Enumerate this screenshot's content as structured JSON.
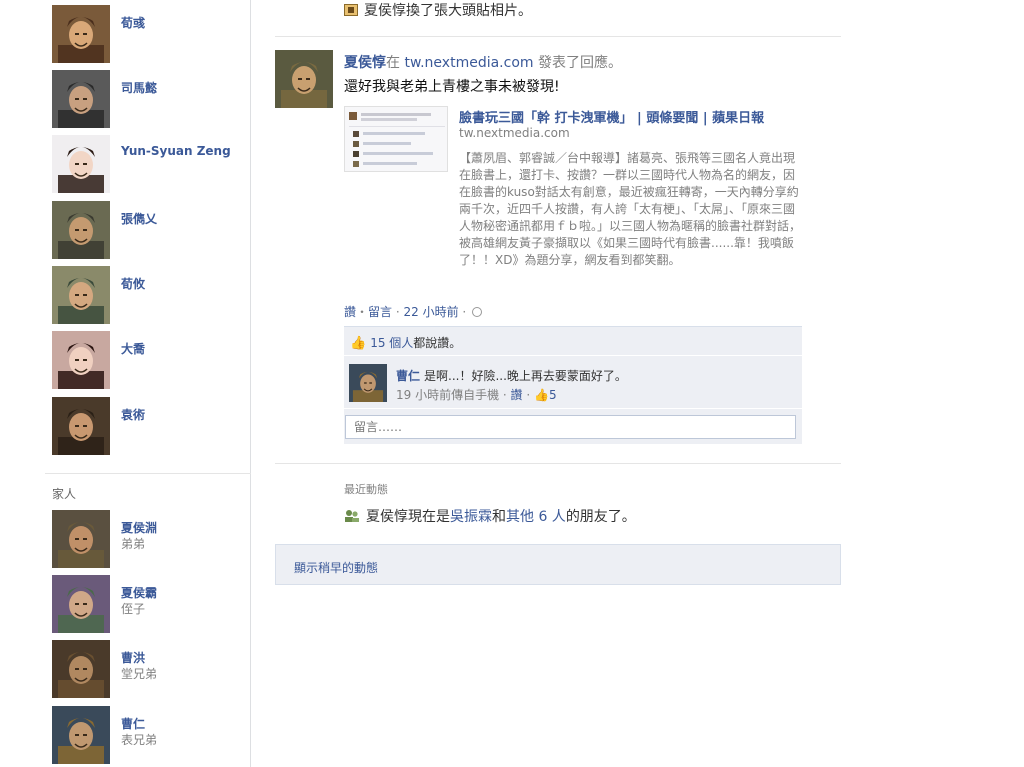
{
  "sidebar": {
    "friends": [
      {
        "name": "荀彧",
        "palette": {
          "bg": "#7a5a3a",
          "face": "#d9a878",
          "hat": "#4a2e1c"
        }
      },
      {
        "name": "司馬懿",
        "palette": {
          "bg": "#5a5a5a",
          "face": "#c8a080",
          "hat": "#2a2a2a"
        }
      },
      {
        "name": "Yun-Syuan Zeng",
        "palette": {
          "bg": "#f0eef0",
          "face": "#f2d6c6",
          "hat": "#2a1a14"
        }
      },
      {
        "name": "張儁乂",
        "palette": {
          "bg": "#6a6a52",
          "face": "#c49a70",
          "hat": "#3a3a30"
        }
      },
      {
        "name": "荀攸",
        "palette": {
          "bg": "#8a8a6a",
          "face": "#d4a880",
          "hat": "#3a4a3a"
        }
      },
      {
        "name": "大喬",
        "palette": {
          "bg": "#c8a8a0",
          "face": "#f0d0c0",
          "hat": "#2a1410"
        }
      },
      {
        "name": "袁術",
        "palette": {
          "bg": "#4a3a2a",
          "face": "#c89870",
          "hat": "#2a2016"
        }
      }
    ],
    "family_heading": "家人",
    "family": [
      {
        "name": "夏侯淵",
        "relation": "弟弟",
        "palette": {
          "bg": "#5a5040",
          "face": "#c09068",
          "hat": "#6a5a3a"
        }
      },
      {
        "name": "夏侯霸",
        "relation": "侄子",
        "palette": {
          "bg": "#6a5a7a",
          "face": "#d0a888",
          "hat": "#4a6a4a"
        }
      },
      {
        "name": "曹洪",
        "relation": "堂兄弟",
        "palette": {
          "bg": "#4a3a2a",
          "face": "#b08860",
          "hat": "#6a5030"
        }
      },
      {
        "name": "曹仁",
        "relation": "表兄弟",
        "palette": {
          "bg": "#3a4a5a",
          "face": "#c09870",
          "hat": "#8a6a30"
        }
      }
    ]
  },
  "feed": {
    "top_story": "夏侯惇換了張大頭貼相片。",
    "post": {
      "author": "夏侯惇",
      "verb_prefix": "在",
      "site": "tw.nextmedia.com",
      "verb_suffix": " 發表了回應。",
      "message": "還好我與老弟上青樓之事未被發現!",
      "link": {
        "title": "臉書玩三國「幹 打卡洩軍機」 | 頭條要聞 | 蘋果日報",
        "domain": "tw.nextmedia.com",
        "description": "【蕭夙眉、郭睿誠／台中報導】諸葛亮、張飛等三國名人竟出現在臉書上，還打卡、按讚？一群以三國時代人物為名的網友，因在臉書的kuso對話太有創意，最近被瘋狂轉寄，一天內轉分享約兩千次，近四千人按讚，有人誇「太有梗」、「太屌」、「原來三國人物秘密通訊都用ｆｂ啦。」以三國人物為暱稱的臉書社群對話，被高雄網友黃子豪擷取以《如果三國時代有臉書......靠！我噴飯了！！XD》為題分享，網友看到都笑翻。"
      },
      "actions": {
        "like": "讚",
        "comment": "留言",
        "time": "22 小時前"
      },
      "likes": {
        "count_text": "15 個人",
        "suffix": "都說讚。"
      },
      "comment": {
        "author": "曹仁",
        "text": "是啊...！好險...晚上再去要蒙面好了。",
        "meta_time": "19 小時前傳自手機",
        "meta_like": "讚",
        "like_count": "5",
        "palette": {
          "bg": "#3a4a5a",
          "face": "#c09870",
          "hat": "#8a6a30"
        }
      },
      "comment_placeholder": "留言……",
      "author_palette": {
        "bg": "#5a5a40",
        "face": "#c8a070",
        "hat": "#7a6a40"
      }
    },
    "recent": {
      "heading": "最近動態",
      "prefix": "夏侯惇現在是",
      "friend": "吳振霖",
      "middle": "和",
      "others": "其他 6 人",
      "suffix": "的朋友了。"
    },
    "older_label": "顯示稍早的動態"
  },
  "colors": {
    "link": "#3b5998",
    "muted": "#808080",
    "ufi_bg": "#edeff4",
    "divider": "#e5e5e5"
  }
}
